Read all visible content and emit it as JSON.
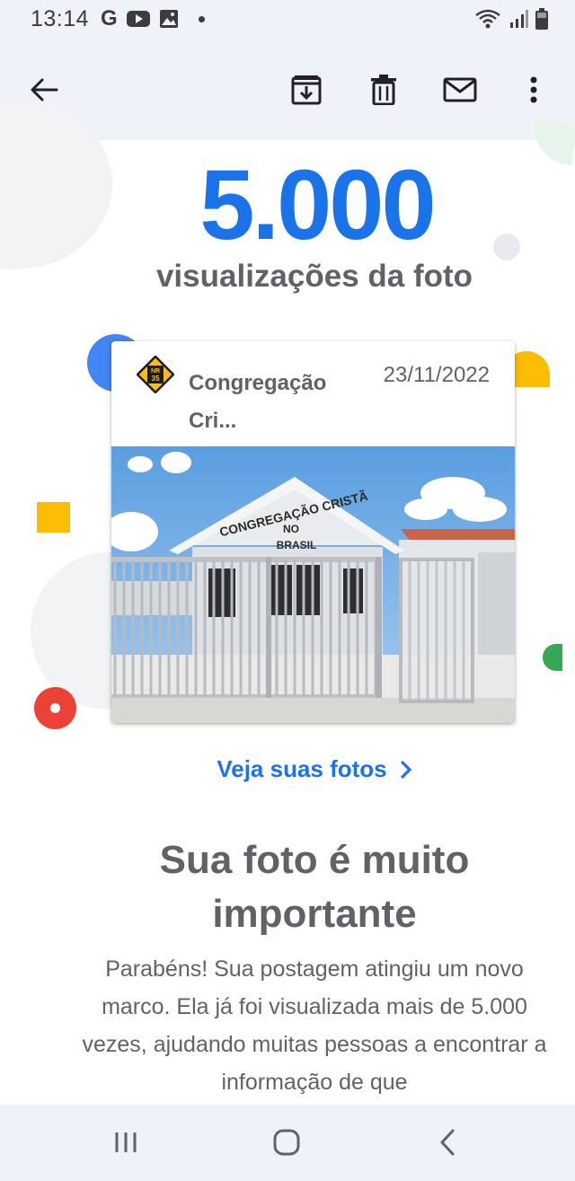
{
  "status_bar": {
    "time": "13:14",
    "left_icons": [
      "google-g-icon",
      "youtube-icon",
      "gallery-icon",
      "notification-dot-icon"
    ],
    "right_icons": [
      "wifi-icon",
      "signal-icon",
      "battery-icon"
    ],
    "google_letter": "G"
  },
  "toolbar": {
    "back_icon": "arrow-left-icon",
    "actions": [
      "archive-icon",
      "delete-icon",
      "mark-unread-icon",
      "more-vert-icon"
    ]
  },
  "milestone": {
    "count": "5.000",
    "label": "visualizações da foto"
  },
  "card": {
    "place_name": "Congregação Cri...",
    "date": "23/11/2022",
    "photo_sign_text": [
      "CONGREGAÇÃO CRISTÃ",
      "NO",
      "BRASIL"
    ],
    "logo_text": [
      "NR",
      "35"
    ]
  },
  "link": {
    "label": "Veja suas fotos"
  },
  "heading": "Sua foto é muito importante",
  "body": "Parabéns! Sua postagem atingiu um novo marco. Ela já foi visualizada mais de 5.000 vezes, ajudando muitas pessoas a encontrar a informação de que",
  "colors": {
    "accent": "#1a73e8",
    "text": "#5f6368",
    "bar_bg": "#eff3f9",
    "google_blue": "#4285f4",
    "google_red": "#ea4335",
    "google_yellow": "#fbbc04",
    "google_green": "#34a853"
  },
  "nav_bar": [
    "recent-apps-icon",
    "home-icon",
    "back-icon"
  ]
}
